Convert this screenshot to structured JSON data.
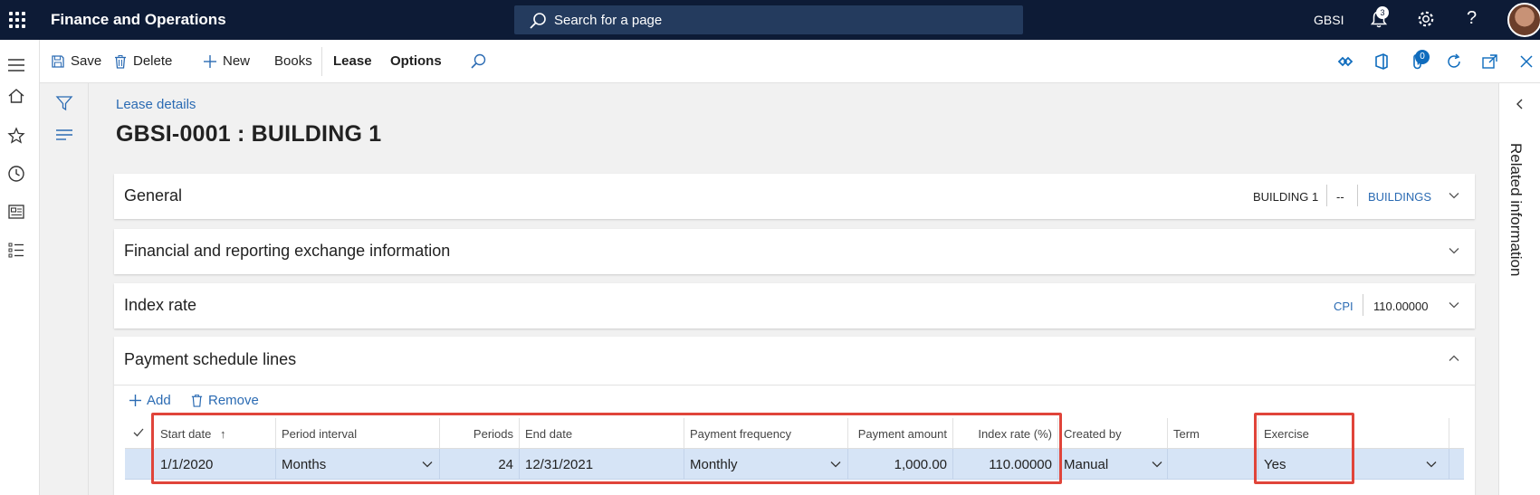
{
  "topbar": {
    "app_title": "Finance and Operations",
    "search_placeholder": "Search for a page",
    "company": "GBSI",
    "notification_count": "3",
    "help_glyph": "?"
  },
  "actionbar": {
    "save": "Save",
    "delete": "Delete",
    "new": "New",
    "books": "Books",
    "lease": "Lease",
    "options": "Options",
    "attach_count": "0"
  },
  "page": {
    "breadcrumb": "Lease details",
    "title": "GBSI-0001 : BUILDING 1"
  },
  "fasttabs": {
    "general": {
      "title": "General",
      "summary_name": "BUILDING 1",
      "summary_dash": "--",
      "summary_group": "BUILDINGS"
    },
    "financial": {
      "title": "Financial and reporting exchange information"
    },
    "index_rate": {
      "title": "Index rate",
      "summary_index": "CPI",
      "summary_value": "110.00000"
    },
    "payment": {
      "title": "Payment schedule lines",
      "add": "Add",
      "remove": "Remove"
    }
  },
  "grid": {
    "columns": [
      "Start date",
      "Period interval",
      "Periods",
      "End date",
      "Payment frequency",
      "Payment amount",
      "Index rate (%)",
      "Created by",
      "Term",
      "Exercise"
    ],
    "sort_glyph": "↑",
    "rows": [
      {
        "start_date": "1/1/2020",
        "period_interval": "Months",
        "periods": "24",
        "end_date": "12/31/2021",
        "payment_frequency": "Monthly",
        "payment_amount": "1,000.00",
        "index_rate": "110.00000",
        "created_by": "Manual",
        "term": "",
        "exercise": "Yes"
      }
    ]
  },
  "right_panel": {
    "label": "Related information"
  },
  "colors": {
    "nav_bg": "#0d1b36",
    "accent": "#2b6bb3",
    "selected_row": "#d6e4f6",
    "highlight_box": "#e0443a"
  }
}
